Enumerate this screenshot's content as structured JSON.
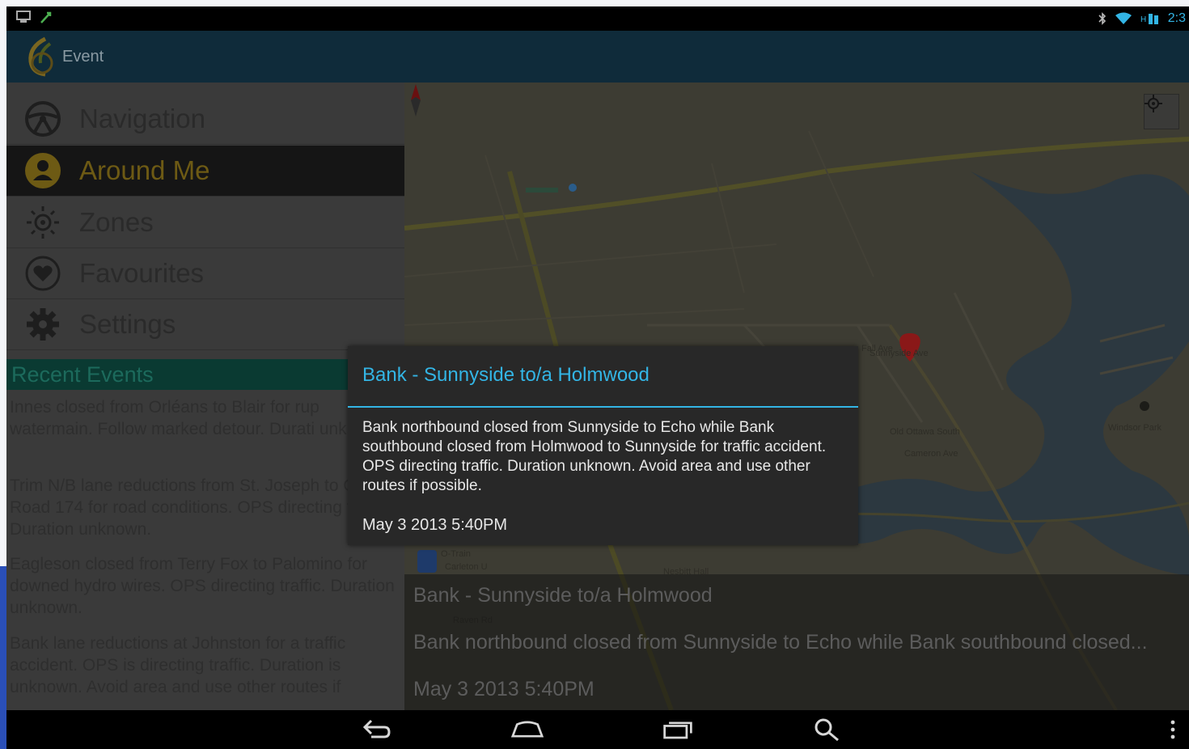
{
  "status_bar": {
    "time": "2:3"
  },
  "action_bar": {
    "title": "Event"
  },
  "drawer": {
    "items": [
      {
        "label": "Navigation",
        "icon": "steering-wheel-icon"
      },
      {
        "label": "Around Me",
        "icon": "person-icon",
        "active": true
      },
      {
        "label": "Zones",
        "icon": "zones-icon"
      },
      {
        "label": "Favourites",
        "icon": "heart-icon"
      },
      {
        "label": "Settings",
        "icon": "gear-icon"
      }
    ],
    "recent_header": "Recent Events",
    "recent_events": [
      "Innes closed from Orléans to Blair for rup watermain. Follow marked detour. Durati unknown.",
      "Trim N/B lane reductions from St. Joseph to Ottawa Road 174 for road conditions. OPS directing traffic. Duration unknown.",
      "Eagleson closed from Terry Fox to Palomino for downed hydro wires. OPS directing traffic. Duration unknown.",
      "Bank lane reductions at Johnston for a traffic accident. OPS is directing traffic. Duration is unknown. Avoid area and use other routes if"
    ]
  },
  "map": {
    "bottom_card": {
      "title": "Bank - Sunnyside to/a Holmwood",
      "description": "Bank northbound closed from Sunnyside to Echo while Bank southbound closed...",
      "date": "May  3 2013  5:40PM"
    }
  },
  "dialog": {
    "title": "Bank - Sunnyside to/a Holmwood",
    "body": "Bank northbound closed from Sunnyside to Echo while Bank southbound closed from Holmwood to Sunnyside for traffic accident.  OPS directing traffic.  Duration unknown.  Avoid area and use other routes if possible.",
    "date": "May  3 2013  5:40PM"
  },
  "colors": {
    "accent": "#33b5e5",
    "action_bar": "#0f2b3a",
    "recent_header": "#0a3a32"
  }
}
